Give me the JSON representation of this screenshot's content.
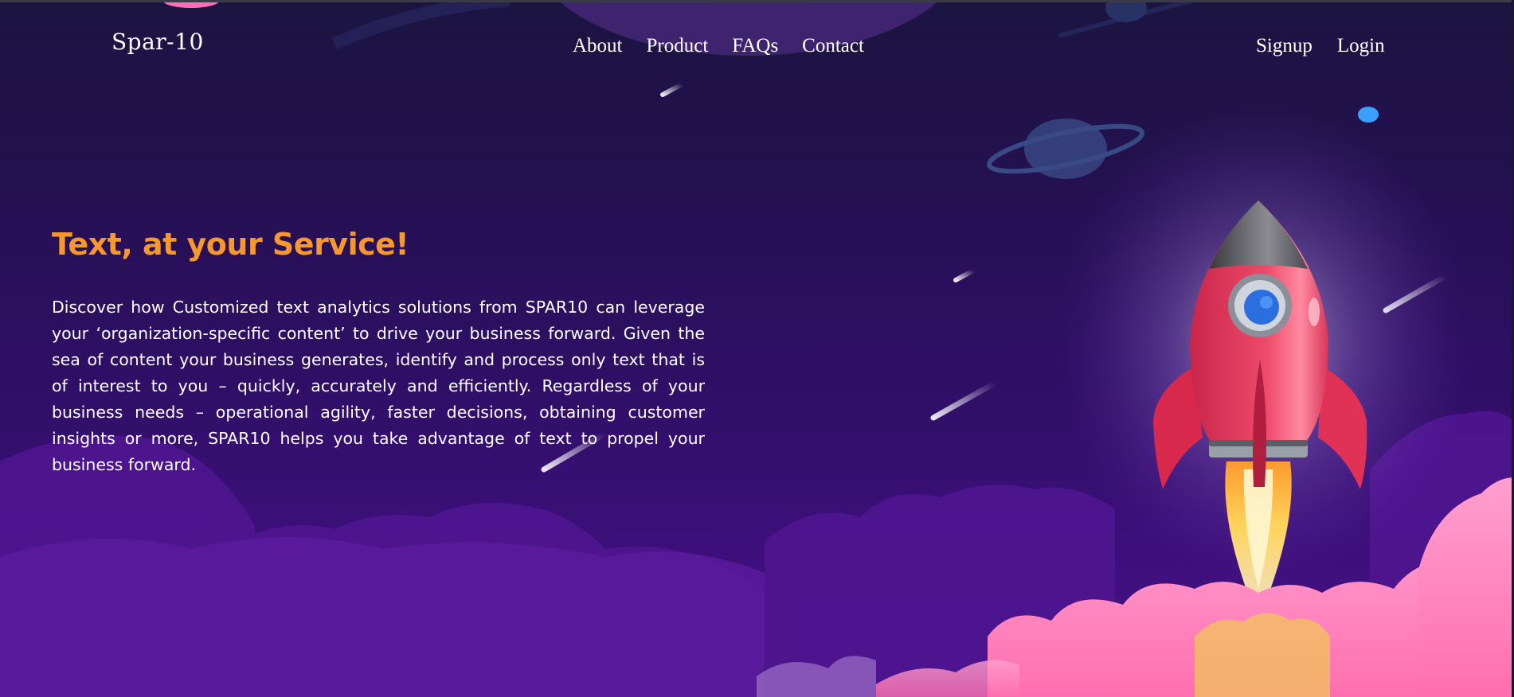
{
  "brand": {
    "name": "Spar-10"
  },
  "nav": {
    "center": [
      "About",
      "Product",
      "FAQs",
      "Contact"
    ],
    "right": [
      "Signup",
      "Login"
    ]
  },
  "hero": {
    "title": "Text, at your Service!",
    "body": "Discover how Customized text analytics solutions from SPAR10 can leverage your ‘organization-specific content’ to drive your business forward. Given the sea of content your business generates, identify and process only text that is of interest to you – quickly, accurately and efficiently. Regardless of your business needs – operational agility, faster decisions, obtaining customer insights or more, SPAR10 helps you take advantage of text to propel your business forward."
  },
  "colors": {
    "accent": "#f7982c",
    "background_top": "#1b1440",
    "background_bottom": "#4a1488",
    "rocket_body": "#e83a5c",
    "cloud_pink": "#ff7fb8"
  },
  "icons": [
    "rocket-illustration",
    "planet-icon",
    "shooting-star-icon"
  ]
}
